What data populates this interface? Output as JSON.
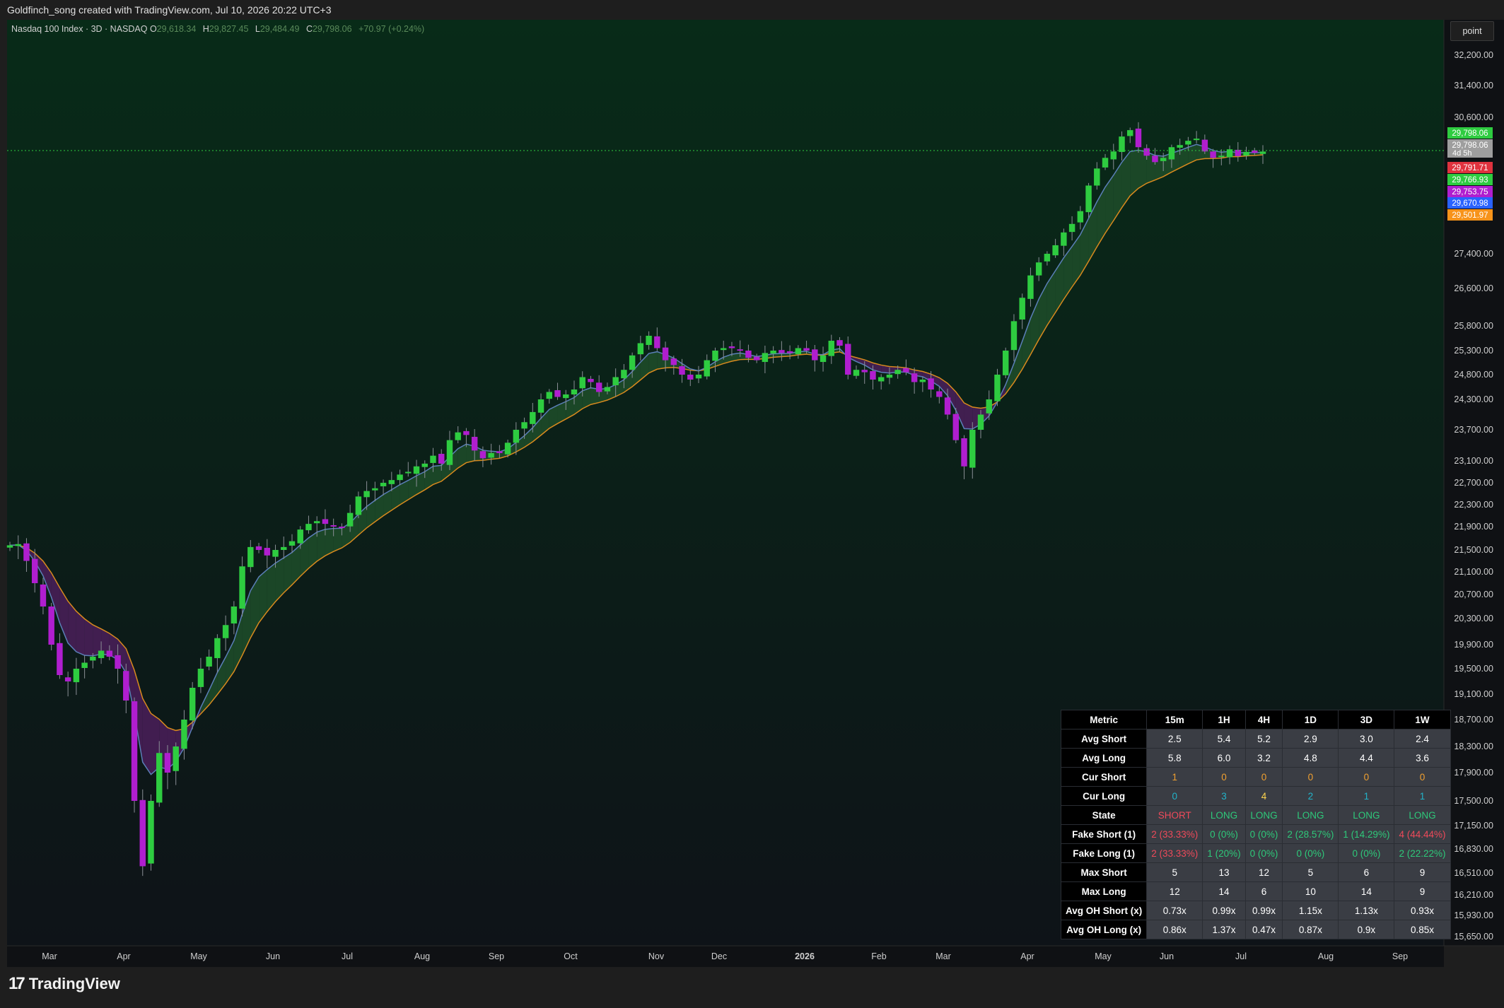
{
  "header": {
    "attribution": "Goldfinch_song created with TradingView.com, Jul 10, 2026 20:22 UTC+3"
  },
  "legend": {
    "symbol": "Nasdaq 100 Index · 3D · NASDAQ",
    "o_label": "O",
    "o_value": "29,618.34",
    "h_label": "H",
    "h_value": "29,827.45",
    "l_label": "L",
    "l_value": "29,484.49",
    "c_label": "C",
    "c_value": "29,798.06",
    "change": "+70.97 (+0.24%)"
  },
  "scale_button": "point",
  "footer": {
    "logo_text": "TradingView"
  },
  "colors": {
    "up_candle": "#2ecc40",
    "down_candle": "#b01ecf",
    "ema_fast": "#5b7fb8",
    "ema_slow": "#d98a1e",
    "cloud_bull": "#1f4d2a",
    "cloud_bear": "#4b1f5a",
    "background_top": "#082b18",
    "background_bottom": "#0e1318"
  },
  "chart_data": {
    "type": "candlestick",
    "title": "Nasdaq 100 Index · 3D · NASDAQ",
    "y_ticks": [
      "32,200.00",
      "31,400.00",
      "30,600.00",
      "27,400.00",
      "26,600.00",
      "25,800.00",
      "25,300.00",
      "24,800.00",
      "24,300.00",
      "23,700.00",
      "23,100.00",
      "22,700.00",
      "22,300.00",
      "21,900.00",
      "21,500.00",
      "21,100.00",
      "20,700.00",
      "20,300.00",
      "19,900.00",
      "19,500.00",
      "19,100.00",
      "18,700.00",
      "18,300.00",
      "17,900.00",
      "17,500.00",
      "17,150.00",
      "16,830.00",
      "16,510.00",
      "16,210.00",
      "15,930.00",
      "15,650.00"
    ],
    "x_ticks": [
      "Mar",
      "Apr",
      "May",
      "Jun",
      "Jul",
      "Aug",
      "Sep",
      "Oct",
      "Nov",
      "Dec",
      "2026",
      "Feb",
      "Mar",
      "Apr",
      "May",
      "Jun",
      "Jul",
      "Aug",
      "Sep"
    ],
    "price_labels": [
      {
        "value": "29,798.06",
        "color": "#2ecc40",
        "sub": ""
      },
      {
        "value": "29,798.06",
        "color": "#9e9e9e",
        "sub": "4d 5h"
      },
      {
        "value": "29,791.71",
        "color": "#e0323e",
        "sub": ""
      },
      {
        "value": "29,766.93",
        "color": "#2ecc40",
        "sub": ""
      },
      {
        "value": "29,753.75",
        "color": "#b01ecf",
        "sub": ""
      },
      {
        "value": "29,670.98",
        "color": "#2962ff",
        "sub": ""
      },
      {
        "value": "29,501.97",
        "color": "#f7931a",
        "sub": ""
      }
    ],
    "last_price": 29798.06,
    "candles_close": [
      21580,
      21600,
      21300,
      20900,
      20500,
      19900,
      19400,
      19300,
      19500,
      19600,
      19700,
      19800,
      19700,
      19500,
      19000,
      17500,
      16600,
      17500,
      18200,
      17900,
      18300,
      18700,
      19200,
      19500,
      19700,
      20000,
      20200,
      20500,
      21200,
      21550,
      21500,
      21400,
      21500,
      21550,
      21650,
      21850,
      21950,
      22000,
      21950,
      21900,
      21880,
      22150,
      22450,
      22550,
      22600,
      22700,
      22750,
      22850,
      22900,
      23000,
      23050,
      23200,
      23050,
      23500,
      23650,
      23600,
      23300,
      23150,
      23250,
      23250,
      23450,
      23700,
      23850,
      24050,
      24300,
      24450,
      24350,
      24400,
      24500,
      24750,
      24650,
      24450,
      24550,
      24750,
      24900,
      25200,
      25450,
      25600,
      25350,
      25100,
      25000,
      24800,
      24700,
      24800,
      25100,
      25300,
      25350,
      25350,
      25300,
      25150,
      25100,
      25250,
      25300,
      25250,
      25250,
      25350,
      25300,
      25100,
      25200,
      25500,
      25400,
      24800,
      24900,
      24850,
      24700,
      24750,
      24800,
      24900,
      24850,
      24650,
      24700,
      24500,
      24350,
      24000,
      23500,
      23000,
      23700,
      24000,
      24300,
      24800,
      25300,
      25900,
      26400,
      26900,
      27200,
      27400,
      27600,
      27900,
      28100,
      28400,
      29000,
      29400,
      29650,
      29800,
      30150,
      30300,
      29900,
      29700,
      29550,
      29650,
      29900,
      29950,
      30050,
      30100,
      29800,
      29650,
      29700,
      29850,
      29690,
      29790,
      29766,
      29798
    ],
    "stats_table": {
      "columns": [
        "Metric",
        "15m",
        "1H",
        "4H",
        "1D",
        "3D",
        "1W"
      ],
      "rows": [
        {
          "metric": "Avg Short",
          "cells": [
            {
              "t": "2.5",
              "c": "white"
            },
            {
              "t": "5.4",
              "c": "white"
            },
            {
              "t": "5.2",
              "c": "white"
            },
            {
              "t": "2.9",
              "c": "white"
            },
            {
              "t": "3.0",
              "c": "white"
            },
            {
              "t": "2.4",
              "c": "white"
            }
          ]
        },
        {
          "metric": "Avg Long",
          "cells": [
            {
              "t": "5.8",
              "c": "white"
            },
            {
              "t": "6.0",
              "c": "white"
            },
            {
              "t": "3.2",
              "c": "white"
            },
            {
              "t": "4.8",
              "c": "white"
            },
            {
              "t": "4.4",
              "c": "white"
            },
            {
              "t": "3.6",
              "c": "white"
            }
          ]
        },
        {
          "metric": "Cur Short",
          "cells": [
            {
              "t": "1",
              "c": "orange"
            },
            {
              "t": "0",
              "c": "orange"
            },
            {
              "t": "0",
              "c": "orange"
            },
            {
              "t": "0",
              "c": "orange"
            },
            {
              "t": "0",
              "c": "orange"
            },
            {
              "t": "0",
              "c": "orange"
            }
          ]
        },
        {
          "metric": "Cur Long",
          "cells": [
            {
              "t": "0",
              "c": "teal"
            },
            {
              "t": "3",
              "c": "teal"
            },
            {
              "t": "4",
              "c": "yellow"
            },
            {
              "t": "2",
              "c": "teal"
            },
            {
              "t": "1",
              "c": "teal"
            },
            {
              "t": "1",
              "c": "teal"
            }
          ]
        },
        {
          "metric": "State",
          "cells": [
            {
              "t": "SHORT",
              "c": "red"
            },
            {
              "t": "LONG",
              "c": "green"
            },
            {
              "t": "LONG",
              "c": "green"
            },
            {
              "t": "LONG",
              "c": "green"
            },
            {
              "t": "LONG",
              "c": "green"
            },
            {
              "t": "LONG",
              "c": "green"
            }
          ]
        },
        {
          "metric": "Fake Short (1)",
          "cells": [
            {
              "t": "2 (33.33%)",
              "c": "red"
            },
            {
              "t": "0 (0%)",
              "c": "green"
            },
            {
              "t": "0 (0%)",
              "c": "green"
            },
            {
              "t": "2 (28.57%)",
              "c": "green"
            },
            {
              "t": "1 (14.29%)",
              "c": "green"
            },
            {
              "t": "4 (44.44%)",
              "c": "red"
            }
          ]
        },
        {
          "metric": "Fake Long (1)",
          "cells": [
            {
              "t": "2 (33.33%)",
              "c": "red"
            },
            {
              "t": "1 (20%)",
              "c": "green"
            },
            {
              "t": "0 (0%)",
              "c": "green"
            },
            {
              "t": "0 (0%)",
              "c": "green"
            },
            {
              "t": "0 (0%)",
              "c": "green"
            },
            {
              "t": "2 (22.22%)",
              "c": "green"
            }
          ]
        },
        {
          "metric": "Max Short",
          "cells": [
            {
              "t": "5",
              "c": "white"
            },
            {
              "t": "13",
              "c": "white"
            },
            {
              "t": "12",
              "c": "white"
            },
            {
              "t": "5",
              "c": "white"
            },
            {
              "t": "6",
              "c": "white"
            },
            {
              "t": "9",
              "c": "white"
            }
          ]
        },
        {
          "metric": "Max Long",
          "cells": [
            {
              "t": "12",
              "c": "white"
            },
            {
              "t": "14",
              "c": "white"
            },
            {
              "t": "6",
              "c": "white"
            },
            {
              "t": "10",
              "c": "white"
            },
            {
              "t": "14",
              "c": "white"
            },
            {
              "t": "9",
              "c": "white"
            }
          ]
        },
        {
          "metric": "Avg OH Short (x)",
          "cells": [
            {
              "t": "0.73x",
              "c": "white"
            },
            {
              "t": "0.99x",
              "c": "white"
            },
            {
              "t": "0.99x",
              "c": "white"
            },
            {
              "t": "1.15x",
              "c": "white"
            },
            {
              "t": "1.13x",
              "c": "white"
            },
            {
              "t": "0.93x",
              "c": "white"
            }
          ]
        },
        {
          "metric": "Avg OH Long (x)",
          "cells": [
            {
              "t": "0.86x",
              "c": "white"
            },
            {
              "t": "1.37x",
              "c": "white"
            },
            {
              "t": "0.47x",
              "c": "white"
            },
            {
              "t": "0.87x",
              "c": "white"
            },
            {
              "t": "0.9x",
              "c": "white"
            },
            {
              "t": "0.85x",
              "c": "white"
            }
          ]
        }
      ]
    }
  }
}
